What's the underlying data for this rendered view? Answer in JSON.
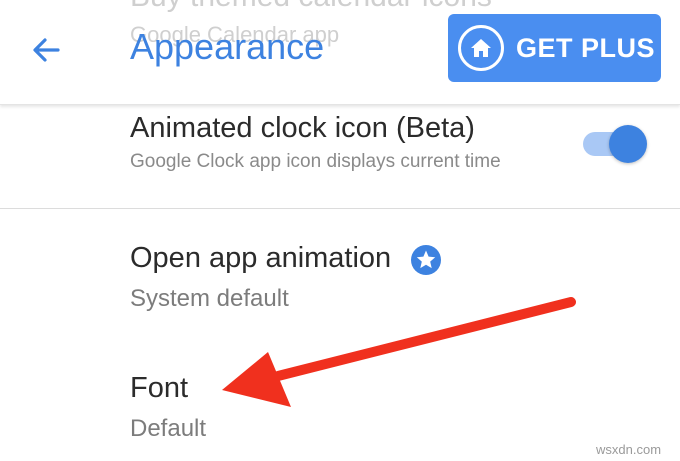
{
  "appbar": {
    "ghost_title": "Buy themed calendar icons",
    "ghost_subtitle": "Google Calendar app",
    "title": "Appearance",
    "get_plus_label": "GET PLUS"
  },
  "settings": {
    "animated_clock": {
      "title": "Animated clock icon (Beta)",
      "subtitle": "Google Clock app icon displays current time",
      "enabled": true
    },
    "open_app_animation": {
      "title": "Open app animation",
      "value": "System default"
    },
    "font": {
      "title": "Font",
      "value": "Default"
    }
  },
  "watermark": "wsxdn.com",
  "colors": {
    "accent": "#3d82e0",
    "button": "#4a8ef0",
    "arrow": "#f0301e"
  }
}
